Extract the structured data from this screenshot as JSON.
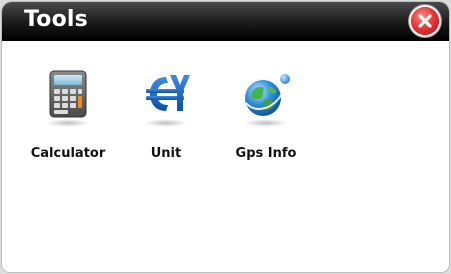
{
  "window": {
    "title": "Tools"
  },
  "tools": [
    {
      "label": "Calculator",
      "icon": "calculator-icon"
    },
    {
      "label": "Unit",
      "icon": "unit-converter-icon"
    },
    {
      "label": "Gps Info",
      "icon": "globe-icon"
    }
  ],
  "colors": {
    "titlebar": "#000000",
    "close": "#e83a3a",
    "background": "#ffffff"
  }
}
